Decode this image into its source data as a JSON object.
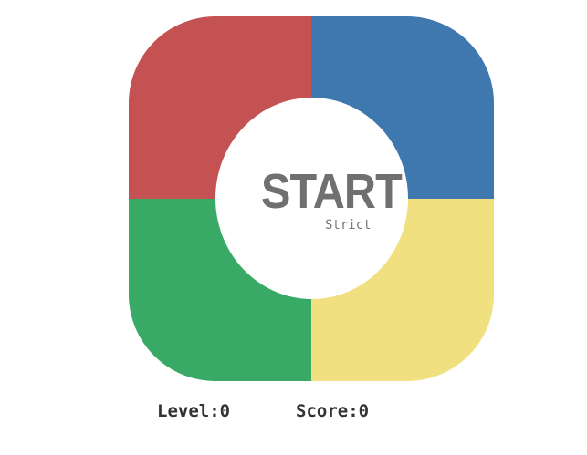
{
  "game": {
    "pads": [
      {
        "id": "red",
        "color": "#c55252"
      },
      {
        "id": "blue",
        "color": "#3e78ae"
      },
      {
        "id": "green",
        "color": "#38aa65"
      },
      {
        "id": "yellow",
        "color": "#f0e07f"
      }
    ],
    "center": {
      "start_label": "START",
      "strict_label": "Strict"
    },
    "status": {
      "level_label": "Level:",
      "level_value": "0",
      "score_label": "Score:",
      "score_value": "0"
    }
  }
}
